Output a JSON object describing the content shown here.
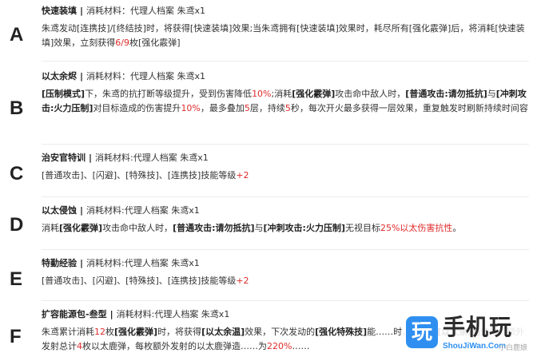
{
  "entries": [
    {
      "letter": "A",
      "name": "快速装填",
      "material": "消耗材料：代理人档案 朱鸢x1",
      "desc": [
        {
          "t": "朱鸢发动[连携技]/[终结技]时，将获得[快速装填]效果;当朱鸢拥有[快速装填]效果时，耗尽所有[强化霰弹]后，将消耗[快速装填]效果，立刻获得"
        },
        {
          "t": "6/9",
          "c": "red"
        },
        {
          "t": "枚[强化霰弹]"
        }
      ]
    },
    {
      "letter": "B",
      "name": "以太余烬",
      "material": "消耗材料：代理人档案 朱鸢x1",
      "desc": [
        {
          "t": "[压制模式]",
          "b": true
        },
        {
          "t": "下，朱鸢的抗打断等级提升，受到伤害降低"
        },
        {
          "t": "10%",
          "c": "red"
        },
        {
          "t": ";消耗"
        },
        {
          "t": "[强化霰弹]",
          "b": true
        },
        {
          "t": "攻击命中敌人时，"
        },
        {
          "t": "[普通攻击:请勿抵抗]",
          "b": true
        },
        {
          "t": "与"
        },
        {
          "t": "[冲刺攻击:火力压制]",
          "b": true
        },
        {
          "t": "对目标造成的伤害提升"
        },
        {
          "t": "10%",
          "c": "red"
        },
        {
          "t": "，最多叠加"
        },
        {
          "t": "5",
          "c": "red"
        },
        {
          "t": "层，持续"
        },
        {
          "t": "5",
          "c": "red"
        },
        {
          "t": "秒，每次开火最多获得一层效果，重复触发时刷新持续时间容"
        }
      ]
    },
    {
      "letter": "C",
      "name": "治安官特训",
      "material": "消耗材料:代理人档案 朱鸢x1",
      "desc": [
        {
          "t": "[普通攻击]、[闪避]、[特殊技]、[连携技]技能等级"
        },
        {
          "t": "+2",
          "c": "red"
        }
      ]
    },
    {
      "letter": "D",
      "name": "以太侵蚀",
      "material": "消耗材料:代理人档案 朱鸢x1",
      "desc": [
        {
          "t": "消耗"
        },
        {
          "t": "[强化霰弹]",
          "b": true
        },
        {
          "t": "攻击命中敌人时，"
        },
        {
          "t": "[普通攻击:请勿抵抗]",
          "b": true
        },
        {
          "t": "与"
        },
        {
          "t": "[冲刺攻击:火力压制]",
          "b": true
        },
        {
          "t": "无视目标"
        },
        {
          "t": "25%以太伤害抗性",
          "c": "red"
        },
        {
          "t": "。"
        }
      ]
    },
    {
      "letter": "E",
      "name": "特勤经验",
      "material": "消耗材料:代理人档案 朱鸢x1",
      "desc": [
        {
          "t": "[普通攻击]、[闪避]、[特殊技]、[连携技]技能等级"
        },
        {
          "t": "+2",
          "c": "red"
        }
      ]
    },
    {
      "letter": "F",
      "name": "扩容能源包-叁型",
      "material": "消耗材料:代理人档案 朱鸢x1",
      "desc": [
        {
          "t": "朱鸢累计消耗"
        },
        {
          "t": "12",
          "c": "red"
        },
        {
          "t": "枚"
        },
        {
          "t": "[强化霰弹]",
          "b": true
        },
        {
          "t": "时，将获得"
        },
        {
          "t": "[以太余温]",
          "b": true
        },
        {
          "t": "效果，下次发动的"
        },
        {
          "t": "[强化特殊技]",
          "b": true
        },
        {
          "t": "能……时，将消耗"
        },
        {
          "t": "[以太余温]",
          "b": true
        },
        {
          "t": "效果，额外发射总计"
        },
        {
          "t": "4",
          "c": "red"
        },
        {
          "t": "枚以太鹿弹，每枚额外发射的以太鹿弹造……为"
        },
        {
          "t": "220%",
          "c": "red"
        },
        {
          "t": "……"
        }
      ]
    }
  ],
  "watermark": {
    "logo_glyph": "玩",
    "title": "手机玩",
    "url": "ShouJiWan.Com",
    "side_text": "小白鹿娘"
  }
}
